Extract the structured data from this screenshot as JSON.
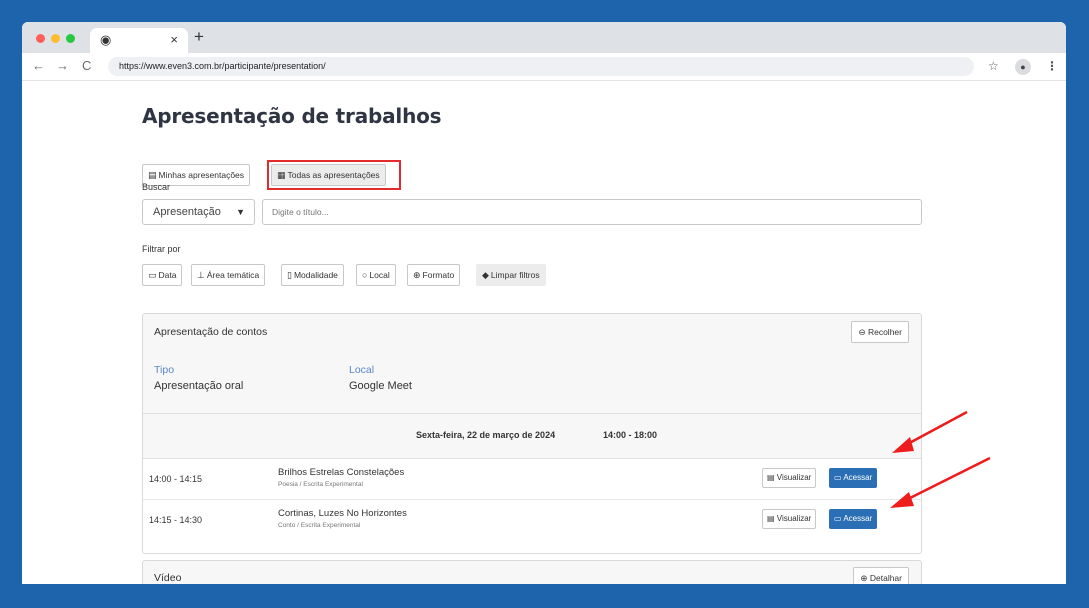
{
  "browser": {
    "tab_favicon": "chrome-icon",
    "tab_close": "×",
    "new_tab": "+",
    "back": "←",
    "forward": "→",
    "reload": "C",
    "url": "https://www.even3.com.br/participante/presentation/",
    "star": "☆",
    "menu": "⋮"
  },
  "page": {
    "title": "Apresentação de trabalhos",
    "tabs": [
      {
        "label": "Minhas apresentações",
        "icon": "presentation-icon"
      },
      {
        "label": "Todas as apresentações",
        "icon": "board-icon"
      }
    ],
    "search_label": "Buscar",
    "search_select": "Apresentação",
    "search_placeholder": "Digite o título...",
    "filter_label": "Filtrar por",
    "filters": [
      {
        "label": "Data",
        "icon": "calendar-icon"
      },
      {
        "label": "Área temática",
        "icon": "flask-icon"
      },
      {
        "label": "Modalidade",
        "icon": "file-icon"
      },
      {
        "label": "Local",
        "icon": "location-icon"
      },
      {
        "label": "Formato",
        "icon": "format-icon"
      },
      {
        "label": "Limpar filtros",
        "icon": "eraser-icon"
      }
    ]
  },
  "session": {
    "title": "Apresentação de contos",
    "collapse_label": "Recolher",
    "type_label": "Tipo",
    "type_value": "Apresentação oral",
    "place_label": "Local",
    "place_value": "Google Meet",
    "day": "Sexta-feira, 22 de março de 2024",
    "day_time": "14:00 - 18:00",
    "items": [
      {
        "time": "14:00 - 14:15",
        "title": "Brilhos Estrelas Constelações",
        "subtitle": "Poesia / Escrita Experimental",
        "view": "Visualizar",
        "access": "Acessar"
      },
      {
        "time": "14:15 - 14:30",
        "title": "Cortinas, Luzes No Horizontes",
        "subtitle": "Conto / Escrita Experimental",
        "view": "Visualizar",
        "access": "Acessar"
      }
    ]
  },
  "session2": {
    "title": "Vídeo",
    "detail_label": "Detalhar"
  },
  "colors": {
    "background": "#1e64ad",
    "accent": "#2a6fb5",
    "highlight": "#e32b2b",
    "label_blue": "#5a86c5"
  }
}
